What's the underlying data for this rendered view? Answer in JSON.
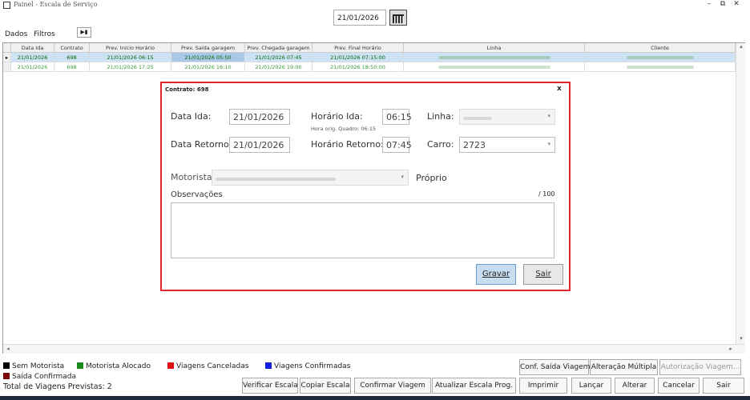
{
  "window": {
    "title": "Painel - Escala de Serviço",
    "minimize": "–",
    "restore": "⧉",
    "close": "✕"
  },
  "header": {
    "date": "21/01/2026",
    "calendar_icon": "calendar-icon"
  },
  "tabs": [
    {
      "label": "Dados"
    },
    {
      "label": "Filtros"
    }
  ],
  "nav_button": "▶▮",
  "grid": {
    "columns": [
      "Data Ida",
      "Contrato",
      "Prev. Início Horário",
      "Prev. Saída garagem",
      "Prev. Chegada garagem",
      "Prev. Final Horário",
      "Linha",
      "Cliente"
    ],
    "rows": [
      {
        "data_ida": "21/01/2026",
        "contrato": "698",
        "inicio": "21/01/2026 06:15",
        "saida": "21/01/2026 05:50",
        "chegada": "21/01/2026 07:45",
        "final": "21/01/2026 07:15:00"
      },
      {
        "data_ida": "21/01/2026",
        "contrato": "698",
        "inicio": "21/01/2026 17:25",
        "saida": "21/01/2026 16:10",
        "chegada": "21/01/2026 19:00",
        "final": "21/01/2026 18:50:00"
      }
    ]
  },
  "dialog": {
    "title": "Contrato: 698",
    "close": "x",
    "data_ida_label": "Data Ida:",
    "data_ida_value": "21/01/2026",
    "horario_ida_label": "Horário Ida:",
    "horario_ida_value": "06:15",
    "hora_orig_note": "Hora orig. Quadro: 06:15",
    "linha_label": "Linha:",
    "data_retorno_label": "Data Retorno:",
    "data_retorno_value": "21/01/2026",
    "horario_retorno_label": "Horário Retorno:",
    "horario_retorno_value": "07:45",
    "carro_label": "Carro:",
    "carro_value": "2723",
    "motorista_label": "Motorista:",
    "proprio_label": "Próprio",
    "observacoes_label": "Observações",
    "observacoes_counter": "/ 100",
    "gravar_label": "Gravar",
    "sair_label": "Sair"
  },
  "legend": {
    "items": [
      {
        "label": "Sem Motorista",
        "color": "#000000"
      },
      {
        "label": "Motorista Alocado",
        "color": "#1a8a1a"
      },
      {
        "label": "Viagens Canceladas",
        "color": "#e01010"
      },
      {
        "label": "Viagens Confirmadas",
        "color": "#1020e0"
      },
      {
        "label": "Saída Confirmada",
        "color": "#7a0a0a"
      }
    ],
    "total": "Total de Viagens Previstas: 2"
  },
  "buttons": {
    "conf_saida": "Conf. Saída Viagem",
    "alteracao_multipla": "Alteração Múltipla",
    "autorizacao": "Autorização Viagem...",
    "verificar": "Verificar Escala",
    "copiar": "Copiar Escala",
    "confirmar": "Confirmar Viagem",
    "atualizar": "Atualizar Escala Prog.",
    "imprimir": "Imprimir",
    "lancar": "Lançar",
    "alterar": "Alterar",
    "cancelar": "Cancelar",
    "sair": "Sair"
  }
}
